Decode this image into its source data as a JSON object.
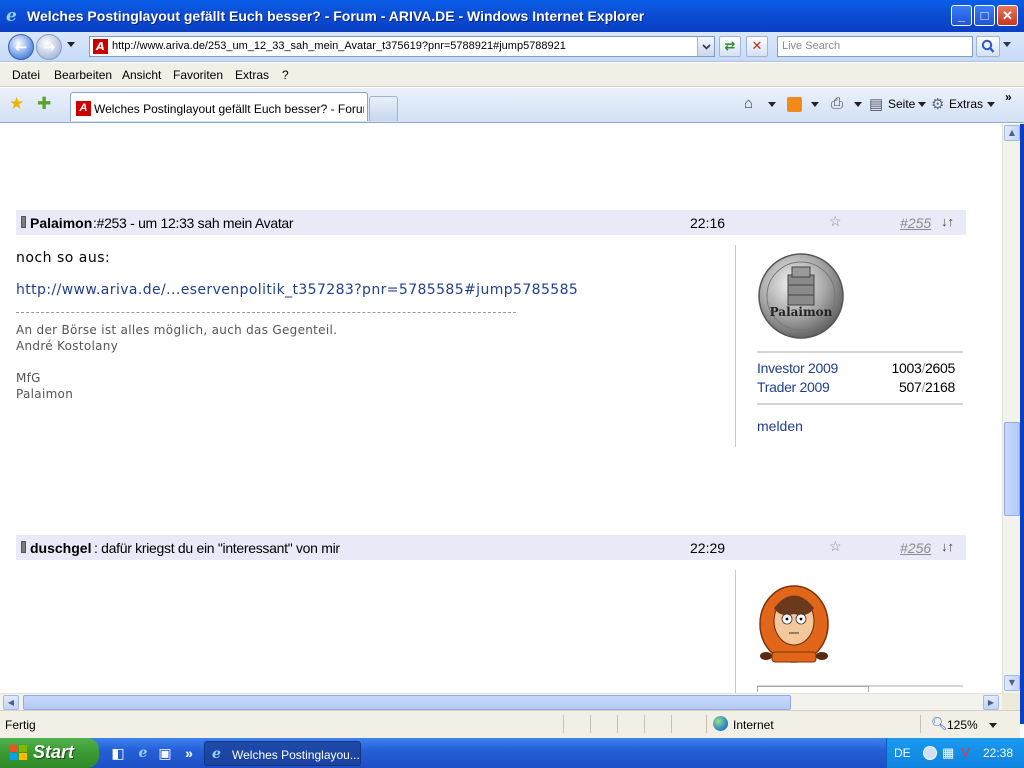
{
  "window": {
    "title": "Welches Postinglayout gefällt Euch besser? - Forum - ARIVA.DE - Windows Internet Explorer"
  },
  "address": {
    "url": "http://www.ariva.de/253_um_12_33_sah_mein_Avatar_t375619?pnr=5788921#jump5788921",
    "search_placeholder": "Live Search"
  },
  "menu": [
    "Datei",
    "Bearbeiten",
    "Ansicht",
    "Favoriten",
    "Extras",
    "?"
  ],
  "tab": {
    "label": "Welches Postinglayout gefällt Euch besser? - Forum - ..."
  },
  "commands": {
    "page": "Seite",
    "tools": "Extras"
  },
  "posts": [
    {
      "author": "Palaimon",
      "subject": ":#253 - um 12:33 sah mein Avatar",
      "time": "22:16",
      "number": "#255",
      "body_line": "noch so aus:",
      "link": "http://www.ariva.de/...eservenpolitik_t357283?pnr=5785585#jump5785585",
      "signature": [
        "An der Börse ist alles möglich, auch das Gegenteil.",
        "André Kostolany",
        "",
        "MfG",
        "Palaimon"
      ],
      "avatar_text": "Palaimon",
      "stats": [
        {
          "label": "Investor 2009",
          "value": "1003",
          "total": "2605"
        },
        {
          "label": "Trader 2009",
          "value": "507",
          "total": "2168"
        }
      ],
      "report": "melden"
    },
    {
      "author": "duschgel",
      "subject": ": dafür kriegst du ein \"interessant\" von mir",
      "time": "22:29",
      "number": "#256"
    }
  ],
  "status": {
    "text": "Fertig",
    "zone": "Internet",
    "zoom": "125%"
  },
  "taskbar": {
    "start": "Start",
    "task_label": "Welches Postinglayou...",
    "lang": "DE",
    "clock": "22:38"
  },
  "colors": {
    "titlebar": "#0b4fd6",
    "post_header_bg": "#e8ebf7",
    "link": "#1f3f8f"
  }
}
